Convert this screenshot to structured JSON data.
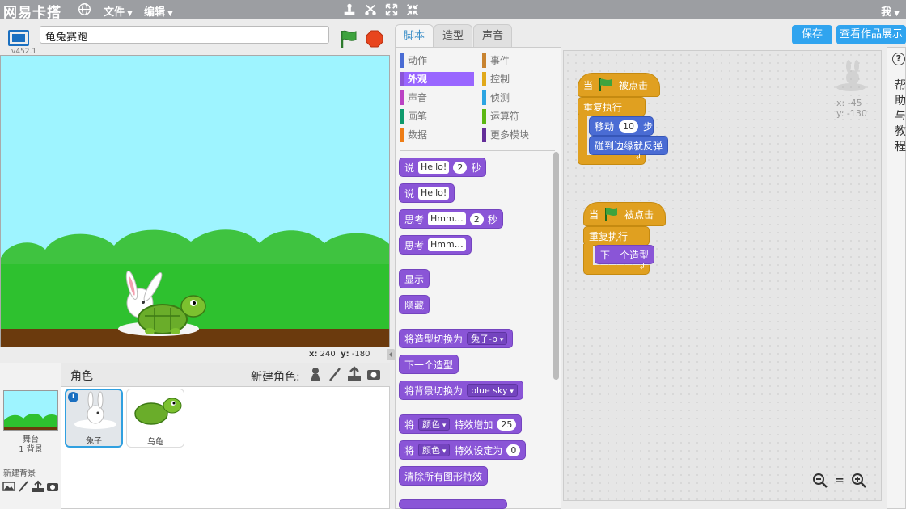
{
  "app": {
    "logo": "网易卡搭",
    "menu_file": "文件",
    "menu_edit": "编辑",
    "user": "我"
  },
  "stage": {
    "version": "v452.1",
    "project_title": "龟兔赛跑",
    "coord_x_label": "x:",
    "coord_x": "240",
    "coord_y_label": "y:",
    "coord_y": "-180"
  },
  "sprites": {
    "header": "角色",
    "new_sprite": "新建角色:",
    "stage_label": "舞台",
    "stage_backdrops": "1 背景",
    "new_backdrop": "新建背景",
    "items": [
      {
        "name": "兔子",
        "selected": true
      },
      {
        "name": "乌龟",
        "selected": false
      }
    ]
  },
  "tabs": [
    "脚本",
    "造型",
    "声音"
  ],
  "categories": [
    {
      "label": "动作",
      "color": "#4a6cd4"
    },
    {
      "label": "事件",
      "color": "#c88330"
    },
    {
      "label": "外观",
      "color": "#8a55d7"
    },
    {
      "label": "控制",
      "color": "#e1a91a"
    },
    {
      "label": "声音",
      "color": "#bb42c3"
    },
    {
      "label": "侦测",
      "color": "#2ca5e2"
    },
    {
      "label": "画笔",
      "color": "#0e9a6c"
    },
    {
      "label": "运算符",
      "color": "#5cb712"
    },
    {
      "label": "数据",
      "color": "#ee7d16"
    },
    {
      "label": "更多模块",
      "color": "#632d99"
    }
  ],
  "palette": {
    "say": "说",
    "hello": "Hello!",
    "two": "2",
    "secs": "秒",
    "think": "思考",
    "hmm": "Hmm…",
    "show": "显示",
    "hide": "隐藏",
    "switch_costume": "将造型切换为",
    "costume_val": "兔子-b",
    "next_costume": "下一个造型",
    "switch_backdrop": "将背景切换为",
    "backdrop_val": "blue sky",
    "set_pre": "将",
    "effect": "颜色",
    "change_effect": "特效增加",
    "change_val": "25",
    "set_effect": "特效设定为",
    "set_val": "0",
    "clear_effects": "清除所有图形特效"
  },
  "scripts": {
    "when": "当",
    "clicked": "被点击",
    "forever": "重复执行",
    "move": "移动",
    "move_val": "10",
    "steps": "步",
    "bounce": "碰到边缘就反弹",
    "next_costume": "下一个造型",
    "sprite_x": "x: -45",
    "sprite_y": "y: -130",
    "zoom_reset": "="
  },
  "buttons": {
    "save": "保存",
    "see_project": "查看作品展示"
  },
  "help": {
    "q": "?",
    "text": "帮助与教程"
  },
  "colors": {
    "accent": "#30a4ef",
    "looks": "#8a55d7",
    "control": "#e0a020",
    "motion": "#4a6cd4"
  }
}
